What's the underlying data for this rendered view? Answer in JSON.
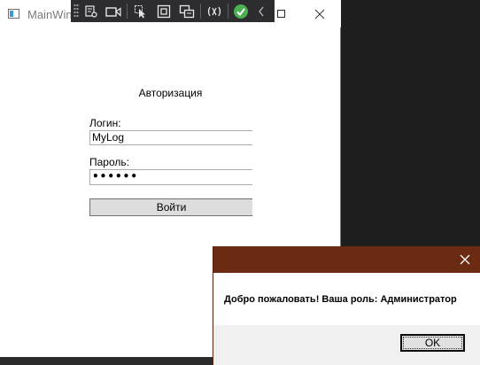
{
  "main_window": {
    "title": "MainWin",
    "heading": "Авторизация",
    "login_label": "Логин:",
    "login_value": "MyLog",
    "password_label": "Пароль:",
    "password_mask": "••••••",
    "submit_label": "Войти"
  },
  "debug_toolbar": {
    "icons": [
      "grip-icon",
      "live-visual-tree-icon",
      "camera-icon",
      "select-element-icon",
      "display-layout-adorners-icon",
      "track-focus-icon",
      "hot-reload-icon",
      "binding-failures-check-icon",
      "collapse-chevron-icon"
    ],
    "accent": "#4caf50"
  },
  "message_box": {
    "message": "Добро пожаловать! Ваша роль: Администратор",
    "ok_label": "OK",
    "titlebar_color": "#6b2a12"
  }
}
